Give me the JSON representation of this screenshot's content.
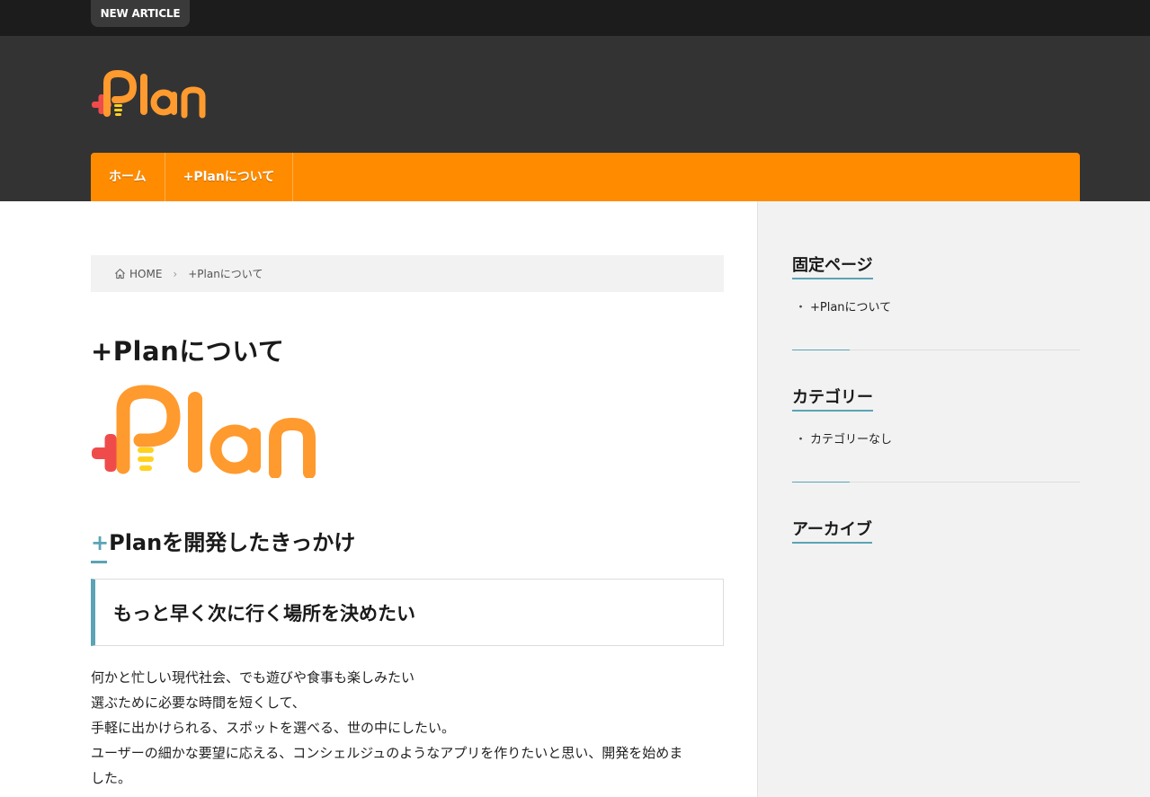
{
  "topbar": {
    "new_article": "NEW ARTICLE"
  },
  "logo": {
    "text": "+Plan"
  },
  "nav": {
    "items": [
      {
        "label": "ホーム"
      },
      {
        "label": "+Planについて"
      }
    ]
  },
  "breadcrumb": {
    "home": "HOME",
    "current": "+Planについて"
  },
  "article": {
    "title": "+Planについて",
    "h2_plus": "+",
    "h2_text": "Planを開発したきっかけ",
    "h3": "もっと早く次に行く場所を決めたい",
    "paragraph": [
      "何かと忙しい現代社会、でも遊びや食事も楽しみたい",
      "選ぶために必要な時間を短くして、",
      "手軽に出かけられる、スポットを選べる、世の中にしたい。",
      "ユーザーの細かな要望に応える、コンシェルジュのようなアプリを作りたいと思い、開発を始めま",
      "した。"
    ]
  },
  "sidebar": {
    "widgets": [
      {
        "title": "固定ページ",
        "items": [
          "+Planについて"
        ]
      },
      {
        "title": "カテゴリー",
        "items": [
          "カテゴリーなし"
        ]
      },
      {
        "title": "アーカイブ",
        "items": []
      }
    ],
    "bullet": "・"
  },
  "colors": {
    "accent": "#5ba4b5",
    "nav": "#ff8c00",
    "header": "#333333",
    "topbar": "#1c1c1c",
    "logo_orange": "#ff9a2e",
    "logo_red": "#f04b4b",
    "logo_yellow": "#ffd21f"
  }
}
